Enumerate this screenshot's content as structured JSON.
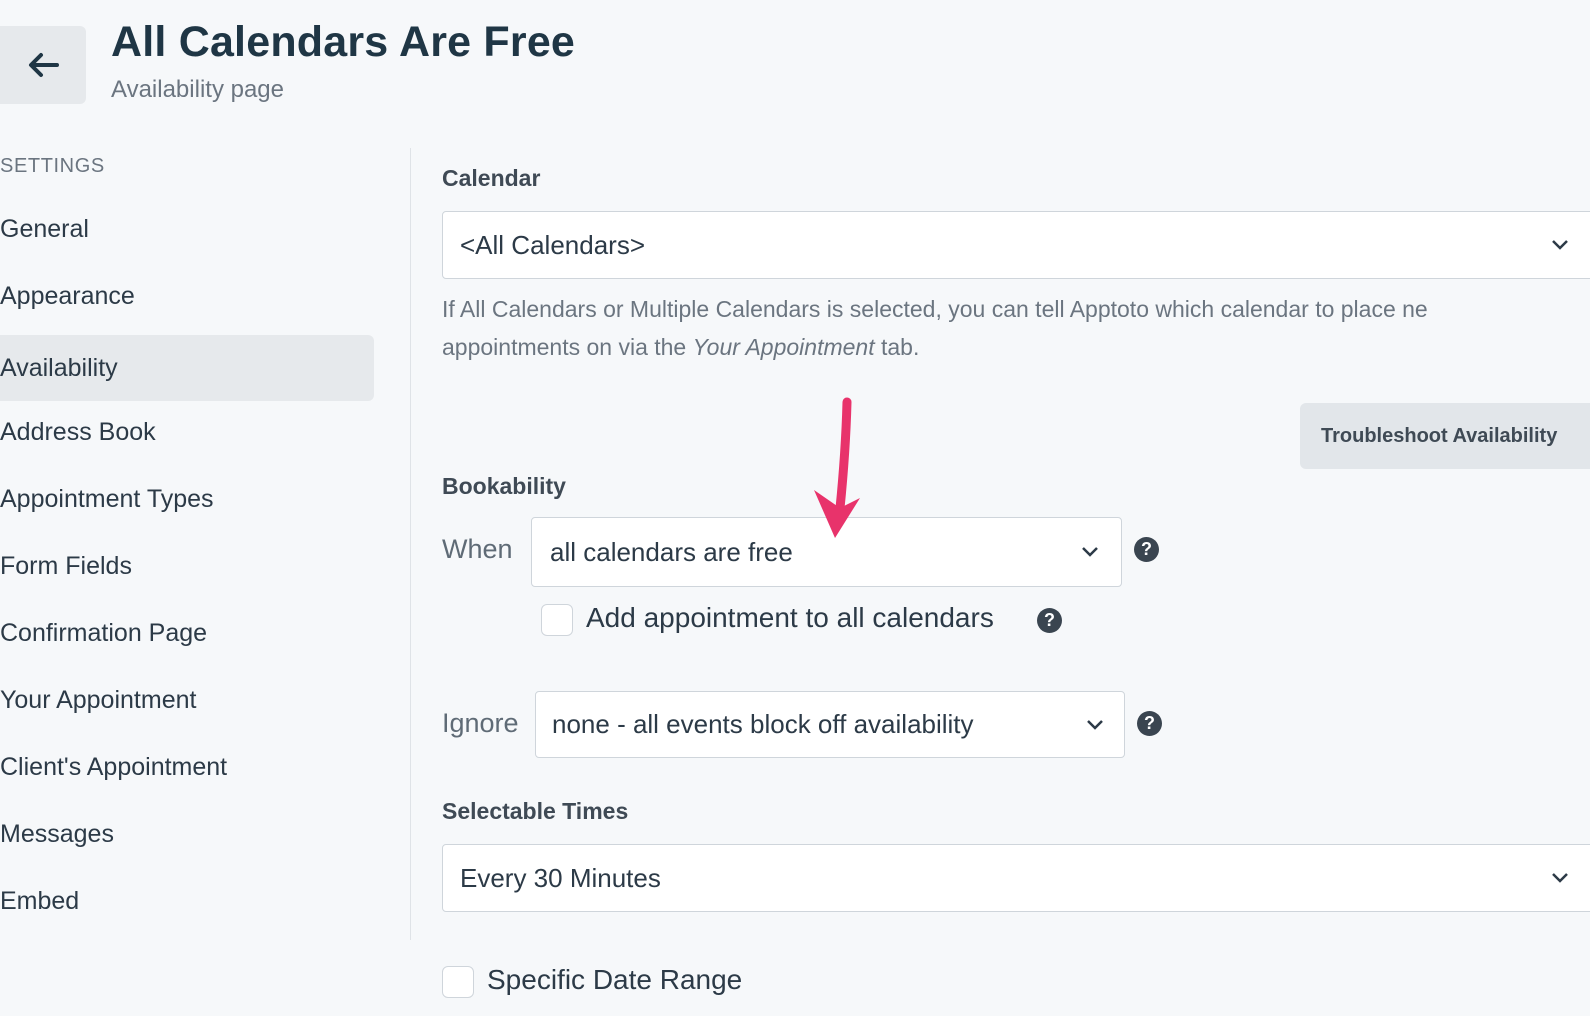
{
  "header": {
    "title": "All Calendars Are Free",
    "subtitle": "Availability page",
    "back_icon": "arrow-left-icon"
  },
  "sidebar": {
    "heading": "SETTINGS",
    "items": [
      {
        "label": "General",
        "active": false
      },
      {
        "label": "Appearance",
        "active": false
      },
      {
        "label": "Availability",
        "active": true
      },
      {
        "label": "Address Book",
        "active": false
      },
      {
        "label": "Appointment Types",
        "active": false
      },
      {
        "label": "Form Fields",
        "active": false
      },
      {
        "label": "Confirmation Page",
        "active": false
      },
      {
        "label": "Your Appointment",
        "active": false
      },
      {
        "label": "Client's Appointment",
        "active": false
      },
      {
        "label": "Messages",
        "active": false
      },
      {
        "label": "Embed",
        "active": false
      }
    ]
  },
  "calendar": {
    "label": "Calendar",
    "selected": "<All Calendars>",
    "help_line1": "If All Calendars or Multiple Calendars is selected, you can tell Apptoto which calendar to place ne",
    "help_line2_prefix": "appointments on via the ",
    "help_line2_italic": "Your Appointment",
    "help_line2_suffix": " tab."
  },
  "troubleshoot_button": "Troubleshoot Availability",
  "bookability": {
    "label": "Bookability",
    "when_label": "When",
    "when_selected": "all calendars are free",
    "add_to_all_label": "Add appointment to all calendars",
    "add_to_all_checked": false,
    "ignore_label": "Ignore",
    "ignore_selected": "none - all events block off availability",
    "help_glyph": "?"
  },
  "selectable_times": {
    "label": "Selectable Times",
    "selected": "Every 30 Minutes"
  },
  "specific_date_range": {
    "label": "Specific Date Range",
    "checked": false
  },
  "colors": {
    "background": "#f6f8fa",
    "title": "#1f3645",
    "active_nav": "#e6e9ec",
    "annotation_arrow": "#e8336b"
  }
}
